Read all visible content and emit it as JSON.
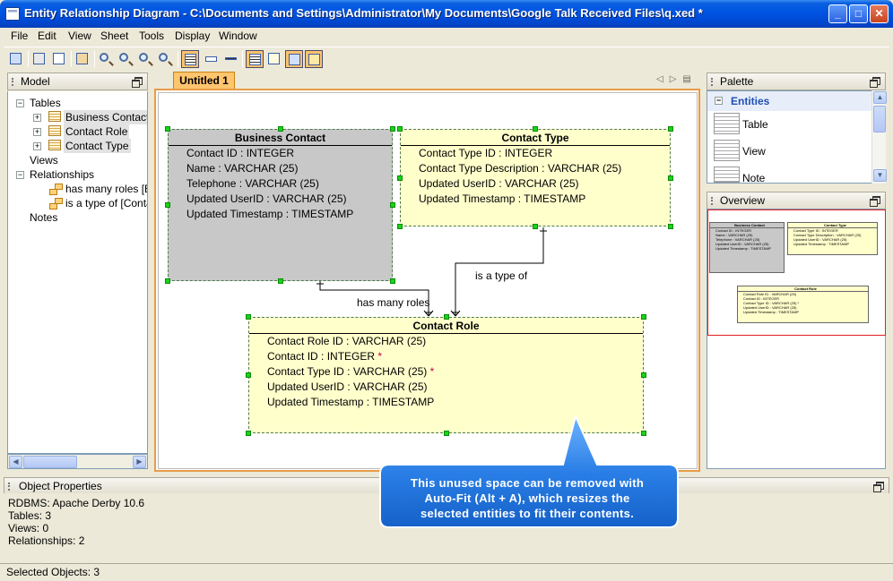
{
  "window": {
    "title": "Entity Relationship Diagram - C:\\Documents and Settings\\Administrator\\My Documents\\Google Talk Received Files\\q.xed *",
    "minimize": "_",
    "maximize": "□",
    "close": "✕"
  },
  "menu": [
    "File",
    "Edit",
    "View",
    "Sheet",
    "Tools",
    "Display",
    "Window"
  ],
  "toolbar_icons": [
    "save-icon",
    "print-icon",
    "page-setup-icon",
    "layout-icon",
    "zoom-icon",
    "zoom-in-icon",
    "zoom-out-icon",
    "zoom-fit-icon",
    "table-icon",
    "column-icon",
    "line-icon",
    "table-outline-icon",
    "null-icon",
    "key-icon",
    "pk-icon"
  ],
  "model_panel": {
    "title": "Model",
    "tables_label": "Tables",
    "tables": [
      "Business Contact",
      "Contact Role",
      "Contact Type"
    ],
    "views_label": "Views",
    "relationships_label": "Relationships",
    "relationships": [
      "has many roles [Bu",
      "is a type of [Conta"
    ],
    "notes_label": "Notes"
  },
  "diagram": {
    "tab_label": "Untitled 1",
    "entities": [
      {
        "name": "Business Contact",
        "fill": "#c8c8c8",
        "rows": [
          "Contact ID : INTEGER",
          "Name : VARCHAR (25)",
          "Telephone : VARCHAR (25)",
          "Updated UserID : VARCHAR (25)",
          "Updated Timestamp : TIMESTAMP"
        ]
      },
      {
        "name": "Contact Type",
        "fill": "#ffffcc",
        "rows": [
          "Contact Type ID : INTEGER",
          "Contact Type Description : VARCHAR (25)",
          "Updated UserID : VARCHAR (25)",
          "Updated Timestamp : TIMESTAMP"
        ]
      },
      {
        "name": "Contact Role",
        "fill": "#ffffcc",
        "rows": [
          "Contact Role ID : VARCHAR (25)",
          "Contact ID : INTEGER",
          "Contact Type ID : VARCHAR (25)",
          "Updated UserID : VARCHAR (25)",
          "Updated Timestamp : TIMESTAMP"
        ],
        "starred_rows": [
          1,
          2
        ]
      }
    ],
    "relationships": [
      "has many roles",
      "is a type of"
    ],
    "star": "*"
  },
  "palette": {
    "title": "Palette",
    "group": "Entities",
    "items": [
      "Table",
      "View",
      "Note"
    ]
  },
  "overview": {
    "title": "Overview",
    "mini": {
      "business_contact": {
        "name": "Business Contact",
        "rows": [
          "Contact ID : INTEGER",
          "Name : VARCHAR (25)",
          "Telephone : VARCHAR (25)",
          "Updated UserID : VARCHAR (25)",
          "Updated Timestamp : TIMESTAMP"
        ]
      },
      "contact_type": {
        "name": "Contact Type",
        "rows": [
          "Contact Type ID : INTEGER",
          "Contact Type Description : VARCHAR (25)",
          "Updated UserID : VARCHAR (25)",
          "Updated Timestamp : TIMESTAMP"
        ]
      },
      "contact_role": {
        "name": "Contact Role",
        "rows": [
          "Contact Role ID : VARCHAR (25)",
          "Contact ID : INTEGER",
          "Contact Type ID : VARCHAR (25) *",
          "Updated UserID : VARCHAR (25)",
          "Updated Timestamp : TIMESTAMP"
        ]
      }
    }
  },
  "object_properties": {
    "title": "Object Properties",
    "lines": [
      "RDBMS: Apache Derby 10.6",
      "Tables: 3",
      "Views: 0",
      "Relationships: 2"
    ]
  },
  "status": "Selected Objects: 3",
  "callout": {
    "lines": [
      "This unused space can be removed with",
      "Auto-Fit (Alt + A), which resizes the",
      "selected entities to fit their contents."
    ]
  },
  "colors": {
    "accent": "#0054e3",
    "tab": "#ffc46e",
    "selection_handle": "#16d416",
    "callout": "#2a7fe6"
  }
}
